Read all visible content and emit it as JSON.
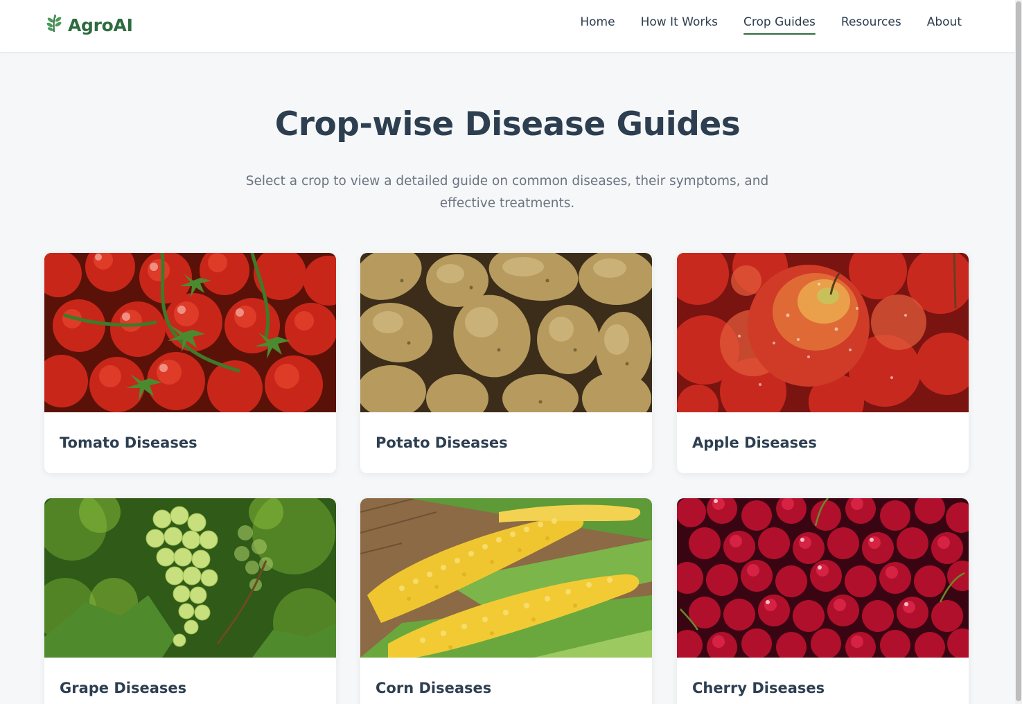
{
  "brand": {
    "name": "AgroAI",
    "logo_icon": "leaf-sprig-icon",
    "color": "#2e6b3f"
  },
  "nav": {
    "items": [
      {
        "label": "Home",
        "active": false
      },
      {
        "label": "How It Works",
        "active": false
      },
      {
        "label": "Crop Guides",
        "active": true
      },
      {
        "label": "Resources",
        "active": false
      },
      {
        "label": "About",
        "active": false
      }
    ]
  },
  "hero": {
    "title": "Crop-wise Disease Guides",
    "subtitle": "Select a crop to view a detailed guide on common diseases, their symptoms, and effective treatments."
  },
  "cards": [
    {
      "title": "Tomato Diseases",
      "image": "tomato-photo"
    },
    {
      "title": "Potato Diseases",
      "image": "potato-photo"
    },
    {
      "title": "Apple Diseases",
      "image": "apple-photo"
    },
    {
      "title": "Grape Diseases",
      "image": "grape-photo"
    },
    {
      "title": "Corn Diseases",
      "image": "corn-photo"
    },
    {
      "title": "Cherry Diseases",
      "image": "cherry-photo"
    }
  ],
  "colors": {
    "background": "#f5f7f9",
    "text": "#2c3e50",
    "muted": "#6b7480",
    "accent": "#2e6b3f"
  }
}
